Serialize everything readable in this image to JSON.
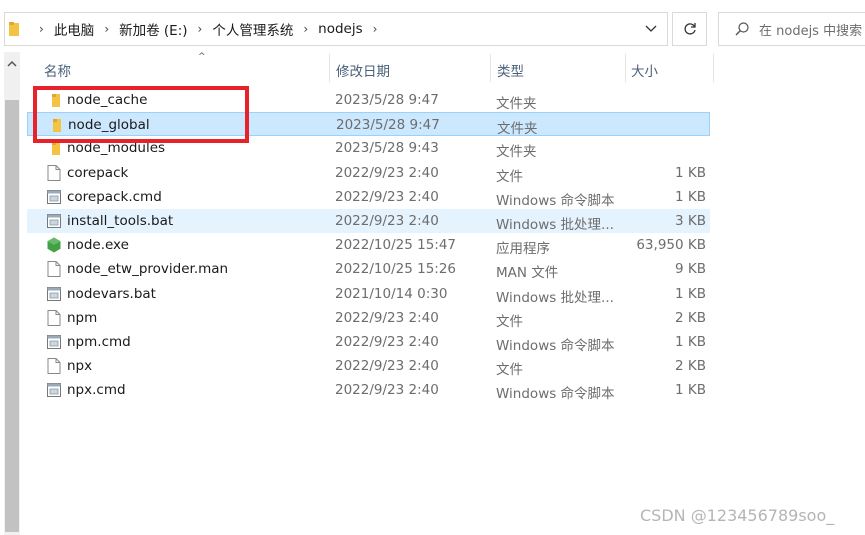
{
  "address_bar": {
    "breadcrumbs": [
      "此电脑",
      "新加卷 (E:)",
      "个人管理系统",
      "nodejs"
    ]
  },
  "search": {
    "placeholder": "在 nodejs 中搜索"
  },
  "columns": {
    "name": "名称",
    "date": "修改日期",
    "type": "类型",
    "size": "大小"
  },
  "files": [
    {
      "name": "node_cache",
      "date": "2023/5/28 9:47",
      "type": "文件夹",
      "size": "",
      "icon": "folder-icon"
    },
    {
      "name": "node_global",
      "date": "2023/5/28 9:47",
      "type": "文件夹",
      "size": "",
      "icon": "folder-icon"
    },
    {
      "name": "node_modules",
      "date": "2023/5/28 9:43",
      "type": "文件夹",
      "size": "",
      "icon": "folder-icon"
    },
    {
      "name": "corepack",
      "date": "2022/9/23 2:40",
      "type": "文件",
      "size": "1 KB",
      "icon": "file-icon"
    },
    {
      "name": "corepack.cmd",
      "date": "2022/9/23 2:40",
      "type": "Windows 命令脚本",
      "size": "1 KB",
      "icon": "script-icon"
    },
    {
      "name": "install_tools.bat",
      "date": "2022/9/23 2:40",
      "type": "Windows 批处理...",
      "size": "3 KB",
      "icon": "script-icon"
    },
    {
      "name": "node.exe",
      "date": "2022/10/25 15:47",
      "type": "应用程序",
      "size": "63,950 KB",
      "icon": "node-exe-icon"
    },
    {
      "name": "node_etw_provider.man",
      "date": "2022/10/25 15:26",
      "type": "MAN 文件",
      "size": "9 KB",
      "icon": "file-icon"
    },
    {
      "name": "nodevars.bat",
      "date": "2021/10/14 0:30",
      "type": "Windows 批处理...",
      "size": "1 KB",
      "icon": "script-icon"
    },
    {
      "name": "npm",
      "date": "2022/9/23 2:40",
      "type": "文件",
      "size": "2 KB",
      "icon": "file-icon"
    },
    {
      "name": "npm.cmd",
      "date": "2022/9/23 2:40",
      "type": "Windows 命令脚本",
      "size": "1 KB",
      "icon": "script-icon"
    },
    {
      "name": "npx",
      "date": "2022/9/23 2:40",
      "type": "文件",
      "size": "2 KB",
      "icon": "file-icon"
    },
    {
      "name": "npx.cmd",
      "date": "2022/9/23 2:40",
      "type": "Windows 命令脚本",
      "size": "1 KB",
      "icon": "script-icon"
    }
  ],
  "selected_index": 1,
  "hover_index": 5,
  "watermark": "CSDN @123456789soo_",
  "colors": {
    "selection": "#cce8ff",
    "highlight_box": "#e8222a",
    "folder": "#f5c343"
  }
}
